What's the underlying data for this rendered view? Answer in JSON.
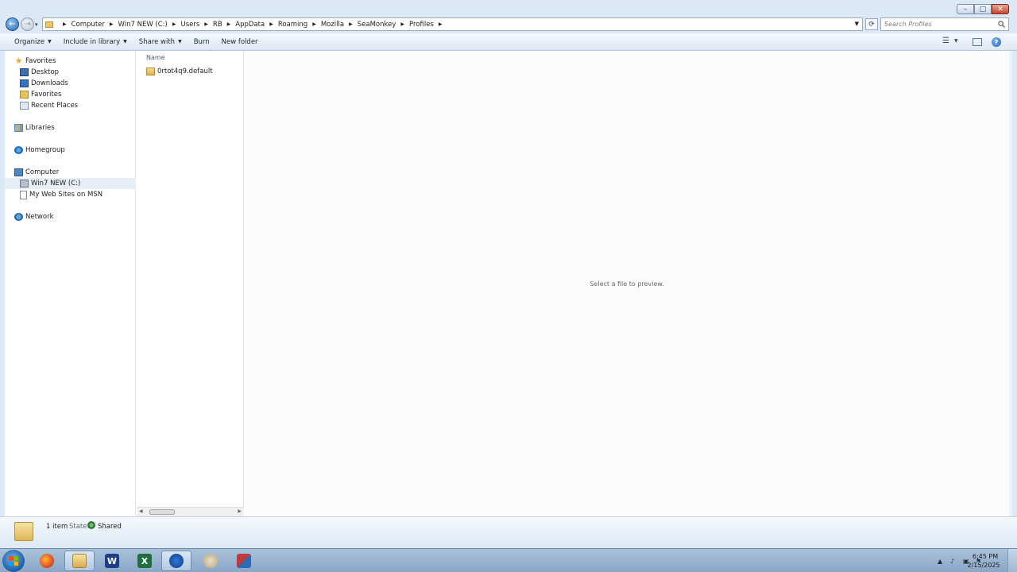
{
  "window": {
    "minimize_label": "–",
    "maximize_label": "□",
    "close_label": "✕"
  },
  "navigation": {
    "back_label": "←",
    "forward_label": "→",
    "recent_label": "▾",
    "refresh_label": "⟳"
  },
  "address": {
    "breadcrumbs": [
      "Computer",
      "Win7 NEW (C:)",
      "Users",
      "RB",
      "AppData",
      "Roaming",
      "Mozilla",
      "SeaMonkey",
      "Profiles"
    ]
  },
  "search": {
    "placeholder": "Search Profiles"
  },
  "toolbar": {
    "organize": "Organize",
    "include_in_library": "Include in library",
    "share_with": "Share with",
    "burn": "Burn",
    "new_folder": "New folder"
  },
  "nav_pane": {
    "favorites": "Favorites",
    "desktop": "Desktop",
    "downloads": "Downloads",
    "favorites_folder": "Favorites",
    "recent_places": "Recent Places",
    "libraries": "Libraries",
    "homegroup": "Homegroup",
    "computer": "Computer",
    "drive_c": "Win7 NEW (C:)",
    "web_sites": "My Web Sites on MSN",
    "network": "Network"
  },
  "file_list": {
    "column_name": "Name",
    "items": [
      {
        "name": "0rtot4q9.default"
      }
    ]
  },
  "preview": {
    "message": "Select a file to preview."
  },
  "details": {
    "count": "1 item",
    "state_label": "State:",
    "state_value": "Shared"
  },
  "taskbar": {
    "apps": [
      "Firefox",
      "Windows Explorer",
      "Microsoft Word",
      "Microsoft Excel",
      "SeaMonkey",
      "Paint",
      "Tool"
    ],
    "word_glyph": "W",
    "excel_glyph": "X",
    "clock_time": "6:45 PM",
    "clock_date": "2/15/2025"
  }
}
